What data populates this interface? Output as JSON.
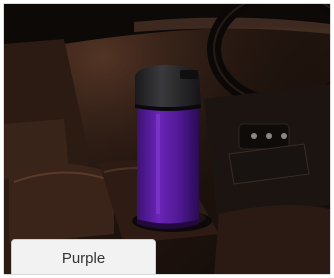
{
  "product": {
    "color_option_label": "Purple",
    "accent_color": "#5a1fa0"
  }
}
